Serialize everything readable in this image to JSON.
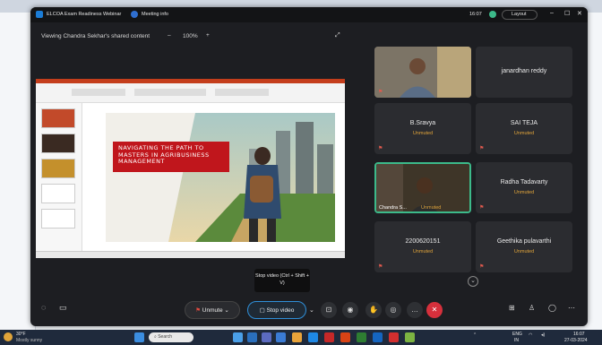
{
  "meeting": {
    "title": "ELCOA Exam Readiness Webinar",
    "meeting_info": "Meeting info",
    "time": "16:07",
    "layout_label": "Layout",
    "sharing_label": "Viewing Chandra Sekhar's shared content",
    "zoom_level": "100%"
  },
  "slide": {
    "title": "NAVIGATING THE PATH TO MASTERS IN AGRIBUSINESS MANAGEMENT"
  },
  "participants": [
    {
      "name": "janardhan reddy",
      "status": ""
    },
    {
      "name": "B.Sravya",
      "status": "Unmuted"
    },
    {
      "name": "SAI TEJA",
      "status": "Unmuted"
    },
    {
      "name": "Chandra S...",
      "status": "Unmuted"
    },
    {
      "name": "Radha Tadavarty",
      "status": "Unmuted"
    },
    {
      "name": "2200620151",
      "status": "Unmuted"
    },
    {
      "name": "Geethika pulavarthi",
      "status": "Unmuted"
    }
  ],
  "controls": {
    "unmute_label": "Unmute",
    "stop_video_label": "Stop video",
    "tooltip": "Stop video (Ctrl + Shift + V)"
  },
  "taskbar": {
    "weather_temp": "30°F",
    "weather_desc": "Mostly sunny",
    "search_placeholder": "Search",
    "lang": "ENG",
    "lang2": "IN",
    "clock_time": "16:07",
    "clock_date": "27-03-2024"
  },
  "colors": {
    "accent_red": "#c0161c",
    "leave_red": "#d6303c",
    "active_green": "#3cba8a",
    "unmuted_orange": "#e0a43a"
  }
}
